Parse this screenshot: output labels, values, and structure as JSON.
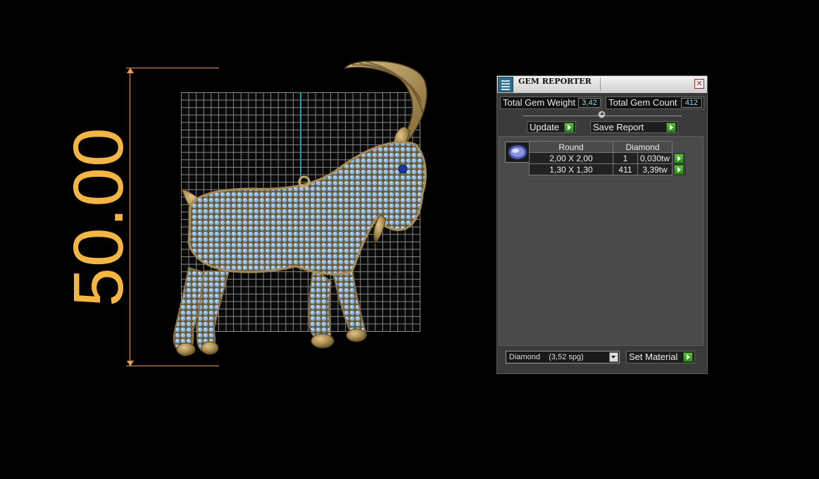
{
  "viewport": {
    "dimension_label": "50.00",
    "colors": {
      "dimension": "#e59b54",
      "dimension_text": "#f4b545",
      "axis": "#1aa3a8",
      "grid": "#8a8a8a"
    }
  },
  "panel": {
    "title": "GEM REPORTER",
    "title_icon": "gem-reporter-icon",
    "close_icon": "close-icon",
    "total_weight_label": "Total Gem Weight",
    "total_weight_value": "3,42",
    "total_count_label": "Total Gem Count",
    "total_count_value": "412",
    "update_label": "Update",
    "save_report_label": "Save Report",
    "table": {
      "shape_header": "Round",
      "material_header": "Diamond",
      "rows": [
        {
          "size": "2,00 X 2,00",
          "count": "1",
          "weight": "0,030tw"
        },
        {
          "size": "1,30 X 1,30",
          "count": "411",
          "weight": "3,39tw"
        }
      ]
    },
    "material_select": "Diamond    (3,52 spg)",
    "set_material_label": "Set Material",
    "colors": {
      "panel_bg": "#3a3a3a",
      "value_text": "#9ad0e6",
      "go_button": "#4aa82e"
    }
  }
}
